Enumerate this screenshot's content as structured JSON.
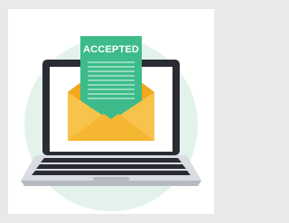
{
  "illustration": {
    "letter_label": "ACCEPTED",
    "icons": {
      "laptop": "laptop-icon",
      "envelope": "open-envelope-icon",
      "letter": "document-icon",
      "keyboard": "keyboard-icon"
    },
    "colors": {
      "page_border": "#e9e9e9",
      "background_circle": "#e3f3ec",
      "laptop_frame": "#2b2b33",
      "laptop_screen": "#ffffff",
      "laptop_base": "#c9cdd3",
      "envelope_back": "#f0a81c",
      "envelope_front": "#f7c34b",
      "letter": "#3dbb8a",
      "letter_lines": "#8fdcbb",
      "keyboard_keys": "#2b2b33"
    }
  }
}
